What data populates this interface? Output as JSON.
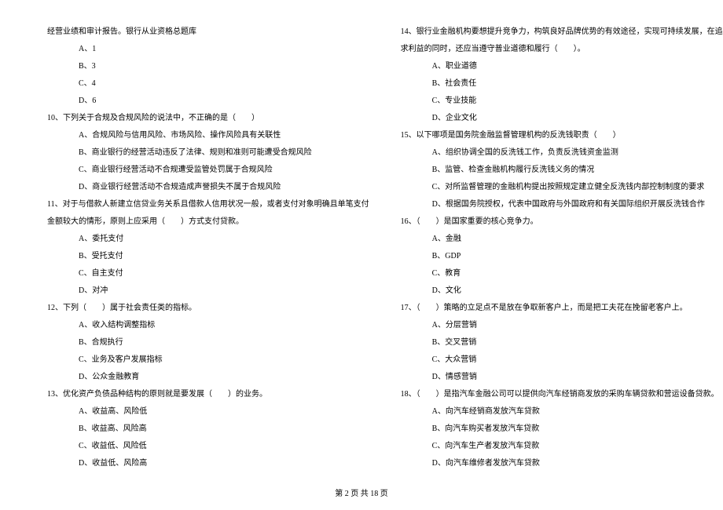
{
  "leftColumn": {
    "intro": "经营业绩和审计报告。银行从业资格总题库",
    "q9": {
      "optA": "A、1",
      "optB": "B、3",
      "optC": "C、4",
      "optD": "D、6"
    },
    "q10": {
      "stem": "10、下列关于合规及合规风险的说法中，不正确的是（　　）",
      "optA": "A、合规风险与信用风险、市场风险、操作风险具有关联性",
      "optB": "B、商业银行的经营活动违反了法律、规则和准则可能遭受合规风险",
      "optC": "C、商业银行经营活动不合规遭受监管处罚属于合规风险",
      "optD": "D、商业银行经营活动不合规造成声誉损失不属于合规风险"
    },
    "q11": {
      "stem": "11、对于与借款人新建立信贷业务关系且借款人信用状况一般，或者支付对象明确且单笔支付",
      "stemCont": "金额较大的情形，原则上应采用（　　）方式支付贷款。",
      "optA": "A、委托支付",
      "optB": "B、受托支付",
      "optC": "C、自主支付",
      "optD": "D、对冲"
    },
    "q12": {
      "stem": "12、下列（　　）属于社会责任类的指标。",
      "optA": "A、收入结构调整指标",
      "optB": "B、合规执行",
      "optC": "C、业务及客户发展指标",
      "optD": "D、公众金融教育"
    },
    "q13": {
      "stem": "13、优化资产负债品种结构的原则就是要发展（　　）的业务。",
      "optA": "A、收益高、风险低",
      "optB": "B、收益高、风险高",
      "optC": "C、收益低、风险低",
      "optD": "D、收益低、风险高"
    }
  },
  "rightColumn": {
    "q14": {
      "stem": "14、银行业金融机构要想提升竞争力，构筑良好品牌优势的有效途径，实现可持续发展，在追",
      "stemCont": "求利益的同时，还应当遵守普业道德和履行（　　）。",
      "optA": "A、职业道德",
      "optB": "B、社会责任",
      "optC": "C、专业技能",
      "optD": "D、企业文化"
    },
    "q15": {
      "stem": "15、以下哪项是国务院金融监督管理机构的反洗钱职责（　　）",
      "optA": "A、组织协调全国的反洗钱工作，负责反洗钱资金监测",
      "optB": "B、监管、检查金融机构履行反洗钱义务的情况",
      "optC": "C、对所监督管理的金融机构提出按照规定建立健全反洗钱内部控制制度的要求",
      "optD": "D、根据国务院授权，代表中国政府与外国政府和有关国际组织开展反洗钱合作"
    },
    "q16": {
      "stem": "16、（　　）是国家重要的核心竞争力。",
      "optA": "A、金融",
      "optB": "B、GDP",
      "optC": "C、教育",
      "optD": "D、文化"
    },
    "q17": {
      "stem": "17、（　　）策略的立足点不是放在争取新客户上，而是把工夫花在挽留老客户上。",
      "optA": "A、分层营销",
      "optB": "B、交叉营销",
      "optC": "C、大众营销",
      "optD": "D、情感营销"
    },
    "q18": {
      "stem": "18、（　　）是指汽车金融公司可以提供向汽车经销商发放的采购车辆贷款和营运设备贷款。",
      "optA": "A、向汽车经销商发放汽车贷款",
      "optB": "B、向汽车购买者发放汽车贷款",
      "optC": "C、向汽车生产者发放汽车贷款",
      "optD": "D、向汽车维修者发放汽车贷款"
    }
  },
  "footer": "第 2 页 共 18 页"
}
